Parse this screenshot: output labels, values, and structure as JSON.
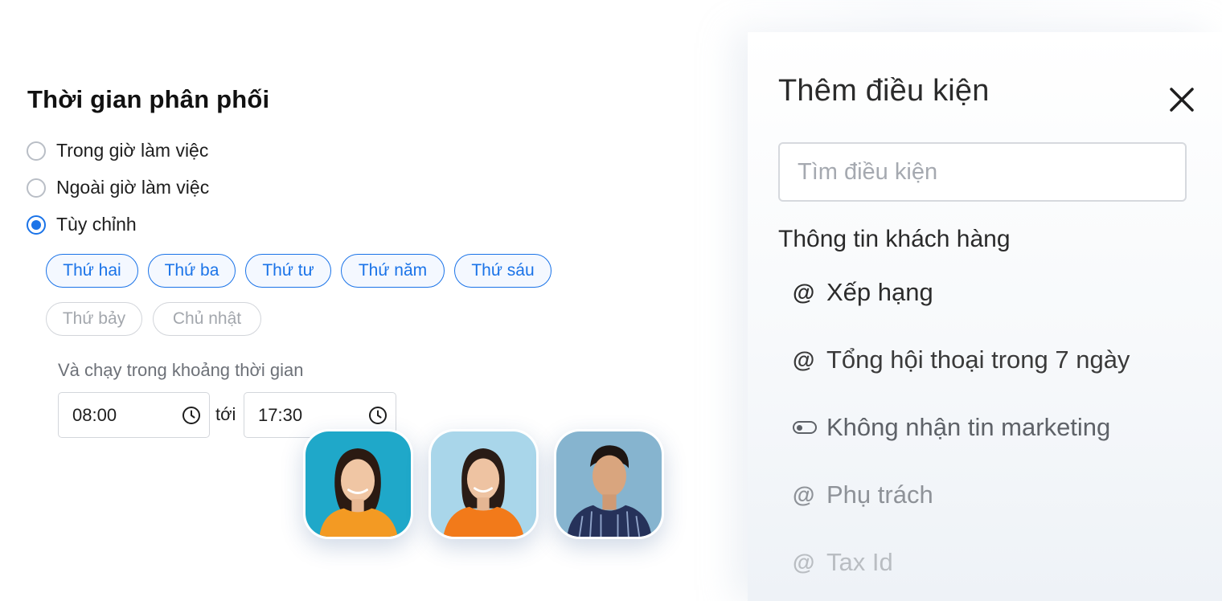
{
  "schedule": {
    "title": "Thời gian phân phối",
    "options": [
      {
        "label": "Trong giờ làm việc",
        "checked": false
      },
      {
        "label": "Ngoài giờ làm việc",
        "checked": false
      },
      {
        "label": "Tùy chỉnh",
        "checked": true
      }
    ],
    "days": [
      {
        "label": "Thứ hai",
        "selected": true
      },
      {
        "label": "Thứ ba",
        "selected": true
      },
      {
        "label": "Thứ tư",
        "selected": true
      },
      {
        "label": "Thứ năm",
        "selected": true
      },
      {
        "label": "Thứ sáu",
        "selected": true
      },
      {
        "label": "Thứ bảy",
        "selected": false
      },
      {
        "label": "Chủ nhật",
        "selected": false
      }
    ],
    "range_label": "Và chạy trong khoảng thời gian",
    "start_time": "08:00",
    "to_label": "tới",
    "end_time": "17:30"
  },
  "avatars": [
    {
      "name": "avatar-woman-1",
      "bg": "#1fa8c9"
    },
    {
      "name": "avatar-woman-2",
      "bg": "#a9d6ea"
    },
    {
      "name": "avatar-man",
      "bg": "#86b4cf"
    }
  ],
  "condition_panel": {
    "title": "Thêm điều kiện",
    "search_placeholder": "Tìm điều kiện",
    "group_title": "Thông tin khách hàng",
    "items": [
      {
        "icon": "at-icon",
        "label": "Xếp hạng",
        "color": "#2c2c2c"
      },
      {
        "icon": "at-icon",
        "label": "Tổng hội thoại trong 7 ngày",
        "color": "#3a3a3a"
      },
      {
        "icon": "toggle-icon",
        "label": "Không nhận tin marketing",
        "color": "#5e6268"
      },
      {
        "icon": "at-icon",
        "label": "Phụ trách",
        "color": "#8e9298"
      },
      {
        "icon": "at-icon",
        "label": "Tax Id",
        "color": "#b9bdc2"
      }
    ]
  },
  "colors": {
    "accent": "#1a73e8",
    "chip_off_border": "#d2d5da"
  }
}
